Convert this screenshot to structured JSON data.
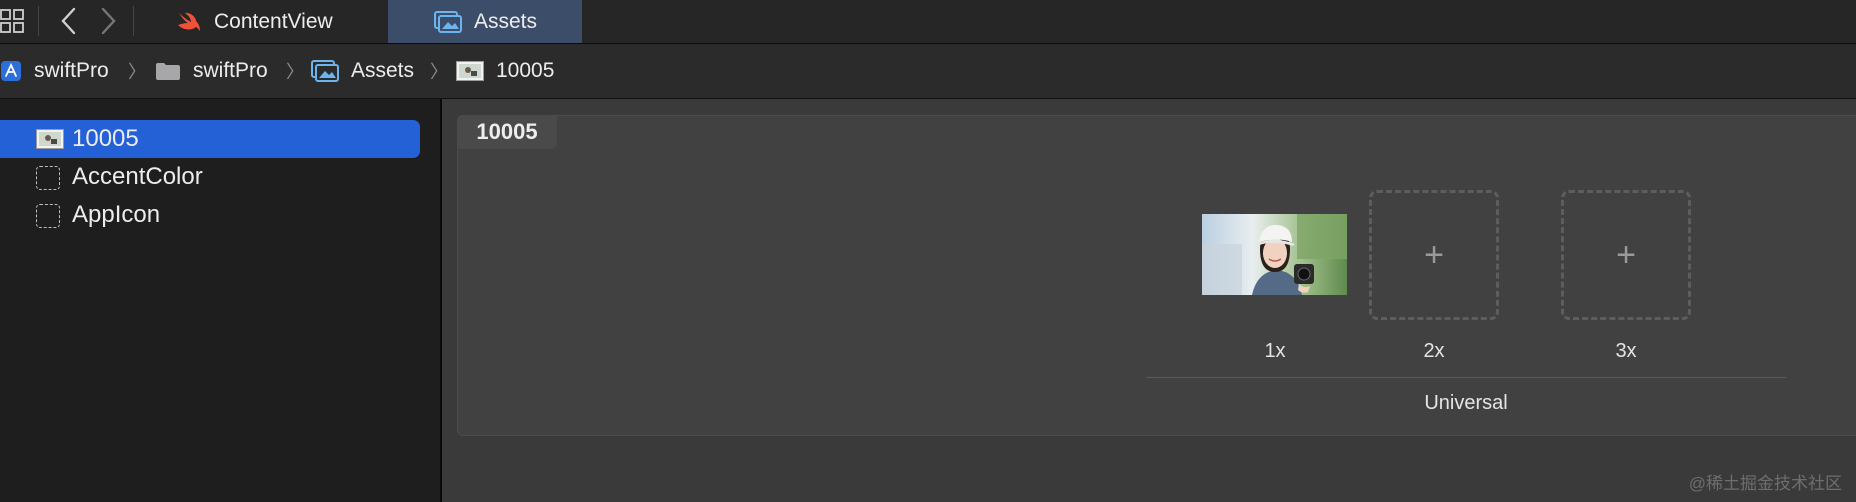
{
  "tabbar": {
    "tabs": [
      {
        "label": "ContentView",
        "icon": "swift-icon"
      },
      {
        "label": "Assets",
        "icon": "assets-icon",
        "active": true
      }
    ]
  },
  "breadcrumb": {
    "items": [
      {
        "label": "swiftPro",
        "icon": "app-project-icon"
      },
      {
        "label": "swiftPro",
        "icon": "folder-icon"
      },
      {
        "label": "Assets",
        "icon": "assets-icon"
      },
      {
        "label": "10005",
        "icon": "image-thumbnail-icon"
      }
    ],
    "separator": "〉"
  },
  "sidebar": {
    "items": [
      {
        "label": "10005",
        "icon": "image-thumbnail-icon",
        "selected": true
      },
      {
        "label": "AccentColor",
        "icon": "color-set-icon"
      },
      {
        "label": "AppIcon",
        "icon": "app-icon-set-icon"
      }
    ]
  },
  "editor": {
    "set_name": "10005",
    "slots": [
      {
        "scale": "1x",
        "filled": true
      },
      {
        "scale": "2x",
        "filled": false,
        "placeholder": "+"
      },
      {
        "scale": "3x",
        "filled": false,
        "placeholder": "+"
      }
    ],
    "group_label": "Universal"
  },
  "watermark": "@稀土掘金技术社区",
  "colors": {
    "selection": "#2461d6",
    "active_tab": "#3b4d68",
    "swift_orange": "#f05138",
    "assets_blue": "#5aa7e8"
  }
}
